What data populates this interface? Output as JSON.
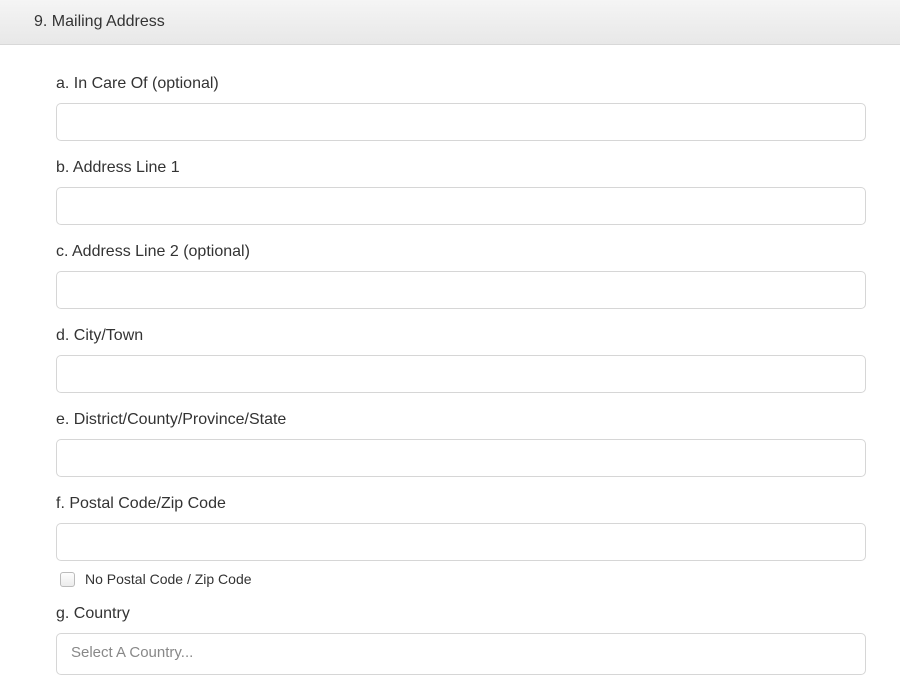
{
  "section": {
    "title": "9. Mailing Address"
  },
  "fields": {
    "a": {
      "label": "a. In Care Of (optional)",
      "value": ""
    },
    "b": {
      "label": "b. Address Line 1",
      "value": ""
    },
    "c": {
      "label": "c. Address Line 2 (optional)",
      "value": ""
    },
    "d": {
      "label": "d. City/Town",
      "value": ""
    },
    "e": {
      "label": "e. District/County/Province/State",
      "value": ""
    },
    "f": {
      "label": "f. Postal Code/Zip Code",
      "value": ""
    },
    "g": {
      "label": "g. Country",
      "placeholder": "Select A Country..."
    }
  },
  "checkbox": {
    "no_postal": {
      "label": "No Postal Code / Zip Code",
      "checked": false
    }
  }
}
